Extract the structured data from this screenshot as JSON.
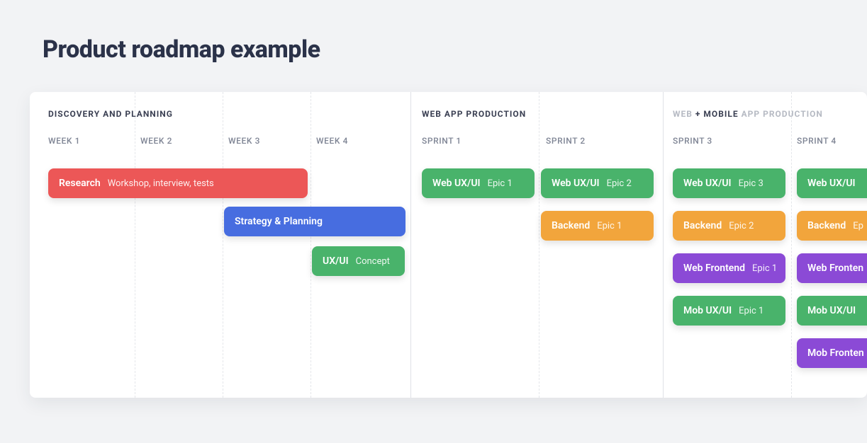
{
  "title": "Product roadmap example",
  "sections": [
    {
      "title_parts": [
        {
          "text": "DISCOVERY AND PLANNING",
          "muted": false
        }
      ]
    },
    {
      "title_parts": [
        {
          "text": "WEB APP PRODUCTION",
          "muted": false
        }
      ]
    },
    {
      "title_parts": [
        {
          "text": "WEB ",
          "muted": true
        },
        {
          "text": "+ MOBILE",
          "muted": false
        },
        {
          "text": " APP PRODUCTION",
          "muted": true
        }
      ]
    }
  ],
  "columns": [
    {
      "label": "WEEK 1"
    },
    {
      "label": "WEEK 2"
    },
    {
      "label": "WEEK 3"
    },
    {
      "label": "WEEK 4"
    },
    {
      "label": "SPRINT 1"
    },
    {
      "label": "SPRINT 2"
    },
    {
      "label": "SPRINT 3"
    },
    {
      "label": "SPRINT 4"
    }
  ],
  "cards": {
    "research": {
      "title": "Research",
      "sub": "Workshop, interview, tests"
    },
    "strategy": {
      "title": "Strategy & Planning",
      "sub": ""
    },
    "uxui_concept": {
      "title": "UX/UI",
      "sub": "Concept"
    },
    "web_uxui_e1": {
      "title": "Web UX/UI",
      "sub": "Epic 1"
    },
    "web_uxui_e2": {
      "title": "Web UX/UI",
      "sub": "Epic 2"
    },
    "web_uxui_e3": {
      "title": "Web UX/UI",
      "sub": "Epic 3"
    },
    "web_uxui_s4": {
      "title": "Web UX/UI",
      "sub": ""
    },
    "backend_e1": {
      "title": "Backend",
      "sub": "Epic 1"
    },
    "backend_e2": {
      "title": "Backend",
      "sub": "Epic 2"
    },
    "backend_s4": {
      "title": "Backend",
      "sub": "Ep"
    },
    "webfe_e1": {
      "title": "Web Frontend",
      "sub": "Epic 1"
    },
    "webfe_s4": {
      "title": "Web Fronten",
      "sub": ""
    },
    "mobux_e1": {
      "title": "Mob UX/UI",
      "sub": "Epic 1"
    },
    "mobux_s4": {
      "title": "Mob UX/UI",
      "sub": ""
    },
    "mobfe_s4": {
      "title": "Mob Fronten",
      "sub": ""
    }
  }
}
